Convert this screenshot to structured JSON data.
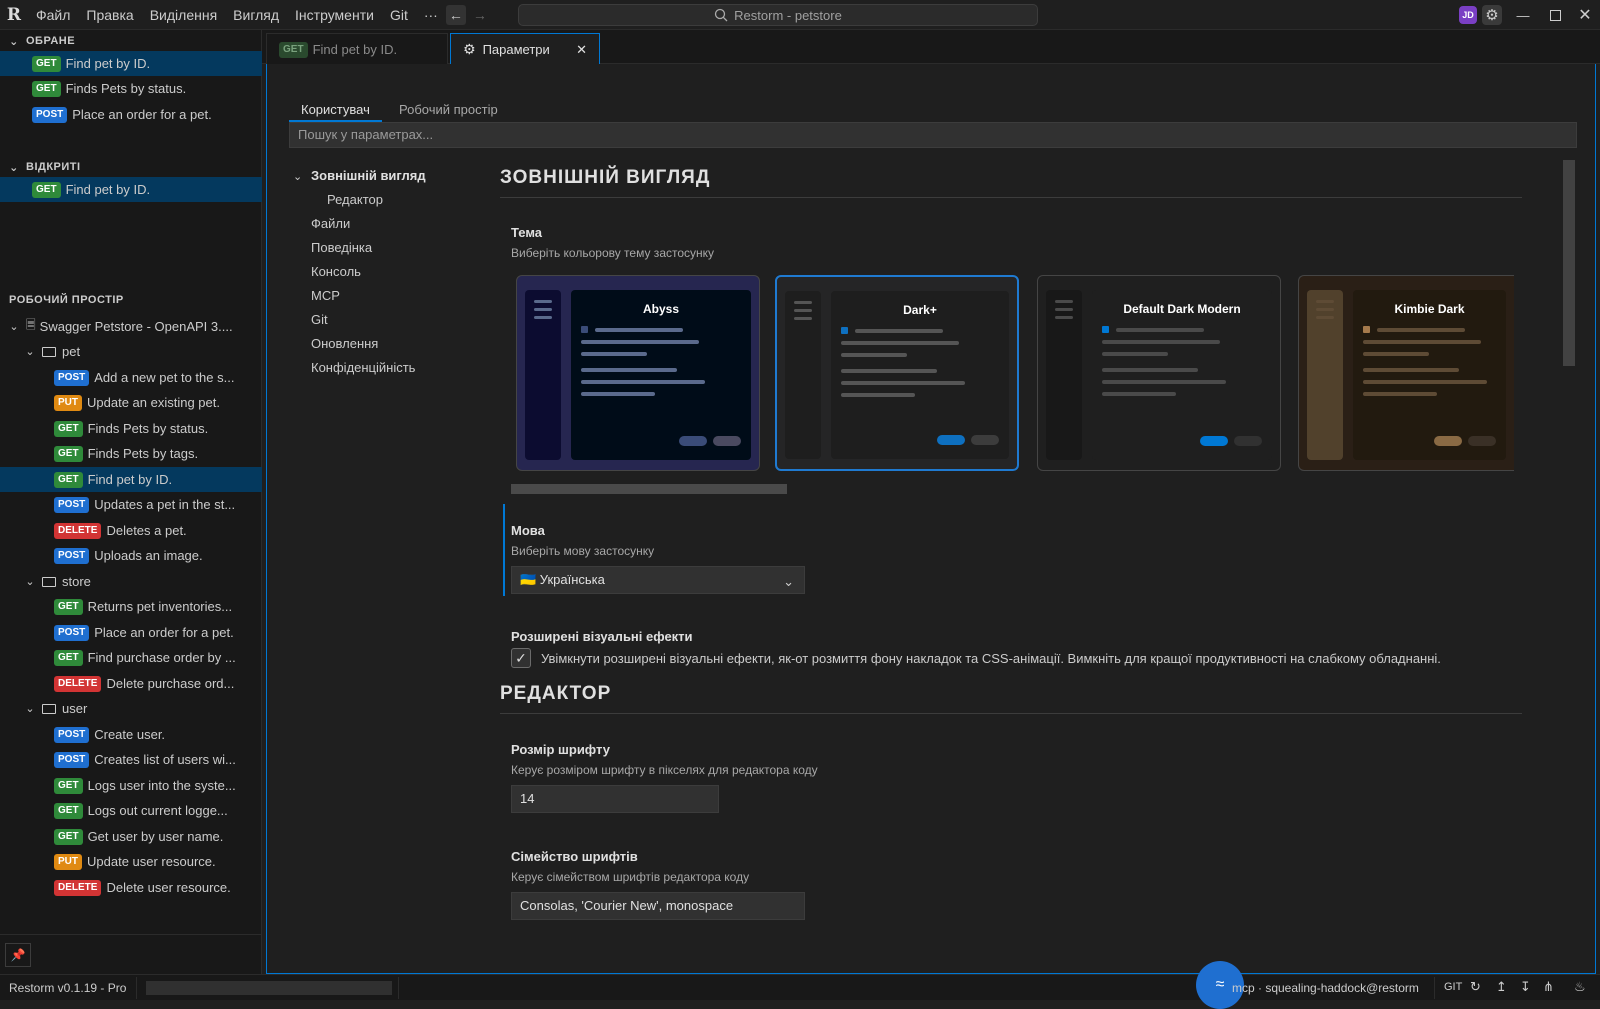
{
  "titlebar": {
    "menu": [
      "Файл",
      "Правка",
      "Виділення",
      "Вигляд",
      "Інструменти",
      "Git",
      "···"
    ],
    "search_text": "Restorm - petstore",
    "avatar": "JD"
  },
  "sidebar": {
    "favorites_header": "ОБРАНЕ",
    "favorites": [
      {
        "method": "GET",
        "label": "Find pet by ID."
      },
      {
        "method": "GET",
        "label": "Finds Pets by status."
      },
      {
        "method": "POST",
        "label": "Place an order for a pet."
      }
    ],
    "open_header": "ВІДКРИТІ",
    "open": [
      {
        "method": "GET",
        "label": "Find pet by ID."
      }
    ],
    "workspace_header": "РОБОЧИЙ ПРОСТІР",
    "collection": "Swagger Petstore - OpenAPI 3....",
    "folders": [
      {
        "name": "pet",
        "items": [
          {
            "method": "POST",
            "label": "Add a new pet to the s..."
          },
          {
            "method": "PUT",
            "label": "Update an existing pet."
          },
          {
            "method": "GET",
            "label": "Finds Pets by status."
          },
          {
            "method": "GET",
            "label": "Finds Pets by tags."
          },
          {
            "method": "GET",
            "label": "Find pet by ID."
          },
          {
            "method": "POST",
            "label": "Updates a pet in the st..."
          },
          {
            "method": "DELETE",
            "label": "Deletes a pet."
          },
          {
            "method": "POST",
            "label": "Uploads an image."
          }
        ]
      },
      {
        "name": "store",
        "items": [
          {
            "method": "GET",
            "label": "Returns pet inventories..."
          },
          {
            "method": "POST",
            "label": "Place an order for a pet."
          },
          {
            "method": "GET",
            "label": "Find purchase order by ..."
          },
          {
            "method": "DELETE",
            "label": "Delete purchase ord..."
          }
        ]
      },
      {
        "name": "user",
        "items": [
          {
            "method": "POST",
            "label": "Create user."
          },
          {
            "method": "POST",
            "label": "Creates list of users wi..."
          },
          {
            "method": "GET",
            "label": "Logs user into the syste..."
          },
          {
            "method": "GET",
            "label": "Logs out current logge..."
          },
          {
            "method": "GET",
            "label": "Get user by user name."
          },
          {
            "method": "PUT",
            "label": "Update user resource."
          },
          {
            "method": "DELETE",
            "label": "Delete user resource."
          }
        ]
      }
    ]
  },
  "tabs": [
    {
      "method": "GET",
      "label": "Find pet by ID."
    },
    {
      "label": "Параметри"
    }
  ],
  "settings": {
    "scope_tabs": [
      "Користувач",
      "Робочий простір"
    ],
    "search_placeholder": "Пошук у параметрах...",
    "toc": [
      "Зовнішній вигляд",
      "Редактор",
      "Файли",
      "Поведінка",
      "Консоль",
      "MCP",
      "Git",
      "Оновлення",
      "Конфіденційність"
    ],
    "appearance_heading": "ЗОВНІШНІЙ ВИГЛЯД",
    "theme_title": "Тема",
    "theme_desc": "Виберіть кольорову тему застосунку",
    "themes": [
      {
        "name": "Abyss",
        "bg": "#262650",
        "side": "#0c0c30",
        "main": "#000c18",
        "bar": "#5a6a8c",
        "accent": "#3a4c78",
        "pill1": "#3a4c78",
        "pill2": "#4a4a60",
        "title": "#ffffff"
      },
      {
        "name": "Dark+",
        "bg": "#252526",
        "side": "#1e1e1e",
        "main": "#1e1e1e",
        "bar": "#555555",
        "accent": "#0e70c0",
        "pill1": "#0e70c0",
        "pill2": "#3c3c3c",
        "title": "#ffffff"
      },
      {
        "name": "Default Dark Modern",
        "bg": "#1f1f1f",
        "side": "#181818",
        "main": "#1f1f1f",
        "bar": "#4a4a4a",
        "accent": "#0078d4",
        "pill1": "#0078d4",
        "pill2": "#313131",
        "title": "#ffffff"
      },
      {
        "name": "Kimbie Dark",
        "bg": "#2a1f16",
        "side": "#51412c",
        "main": "#221a0f",
        "bar": "#5e4b35",
        "accent": "#a57a4c",
        "pill1": "#8a6a44",
        "pill2": "#3a3026",
        "title": "#ffffff"
      }
    ],
    "selected_theme": "Dark+",
    "language_title": "Мова",
    "language_desc": "Виберіть мову застосунку",
    "language_value": "🇺🇦 Українська",
    "effects_title": "Розширені візуальні ефекти",
    "effects_desc": "Увімкнути розширені візуальні ефекти, як-от розмиття фону накладок та CSS-анімації. Вимкніть для кращої продуктивності на слабкому обладнанні.",
    "effects_checked": true,
    "editor_heading": "РЕДАКТОР",
    "font_size_title": "Розмір шрифту",
    "font_size_desc": "Керує розміром шрифту в пікселях для редактора коду",
    "font_size_value": "14",
    "font_family_title": "Сімейство шрифтів",
    "font_family_desc": "Керує сімейством шрифтів редактора коду",
    "font_family_value": "Consolas, 'Courier New', monospace"
  },
  "statusbar": {
    "version": "Restorm v0.1.19 - Pro",
    "mcp": "mcp · squealing-haddock@restorm",
    "git": "GIT"
  },
  "colors": {
    "accent": "#0078d4",
    "selection": "#04395e",
    "get": "#2f8a3a",
    "post": "#1f6fd0",
    "put": "#e08a12",
    "delete": "#d23434"
  }
}
